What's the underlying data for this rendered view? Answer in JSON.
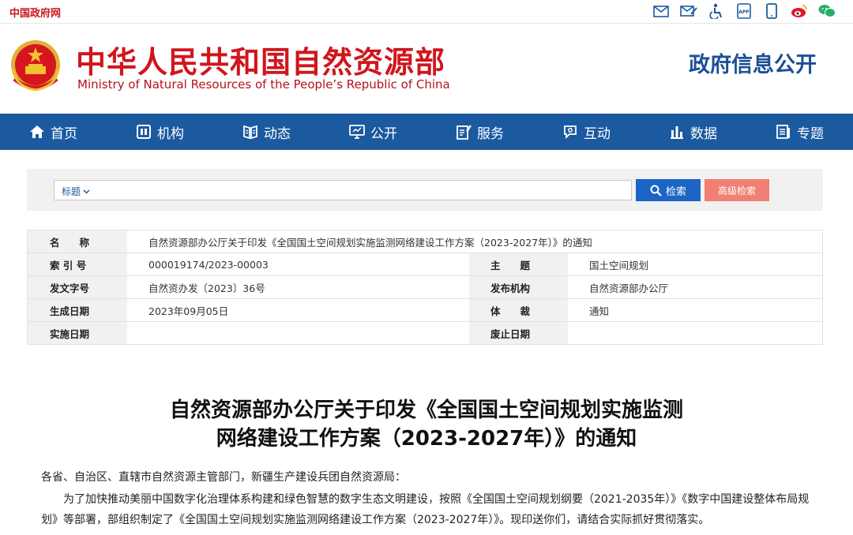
{
  "topbar": {
    "gov_link": "中国政府网",
    "icons": [
      "mail-icon",
      "mail-edit-icon",
      "accessibility-icon",
      "app-icon",
      "mobile-icon",
      "weibo-icon",
      "wechat-icon"
    ]
  },
  "header": {
    "title_cn": "中华人民共和国自然资源部",
    "title_en": "Ministry of Natural Resources of the People’s Republic of China",
    "section": "政府信息公开"
  },
  "nav": {
    "items": [
      {
        "label": "首页",
        "icon": "home-icon"
      },
      {
        "label": "机构",
        "icon": "org-icon"
      },
      {
        "label": "动态",
        "icon": "news-icon"
      },
      {
        "label": "公开",
        "icon": "disclosure-icon"
      },
      {
        "label": "服务",
        "icon": "service-icon"
      },
      {
        "label": "互动",
        "icon": "chat-icon"
      },
      {
        "label": "数据",
        "icon": "chart-icon"
      },
      {
        "label": "专题",
        "icon": "topic-icon"
      }
    ]
  },
  "search": {
    "category": "标题",
    "query": "",
    "search_label": "检索",
    "advanced_label": "高级检索"
  },
  "meta": {
    "name_label": "名　　称",
    "name_value": "自然资源部办公厅关于印发《全国国土空间规划实施监测网络建设工作方案（2023-2027年）》的通知",
    "index_label": "索 引 号",
    "index_value": "000019174/2023-00003",
    "subject_label": "主　　题",
    "subject_value": "国土空间规划",
    "docno_label": "发文字号",
    "docno_value": "自然资办发〔2023〕36号",
    "issuer_label": "发布机构",
    "issuer_value": "自然资源部办公厅",
    "created_label": "生成日期",
    "created_value": "2023年09月05日",
    "genre_label": "体　　裁",
    "genre_value": "通知",
    "effective_label": "实施日期",
    "effective_value": "",
    "expiry_label": "废止日期",
    "expiry_value": ""
  },
  "article": {
    "title_line1": "自然资源部办公厅关于印发《全国国土空间规划实施监测",
    "title_line2": "网络建设工作方案（2023-2027年）》的通知",
    "salutation": "各省、自治区、直辖市自然资源主管部门，新疆生产建设兵团自然资源局：",
    "body": "为了加快推动美丽中国数字化治理体系构建和绿色智慧的数字生态文明建设，按照《全国国土空间规划纲要（2021-2035年）》《数字中国建设整体布局规划》等部署，部组织制定了《全国国土空间规划实施监测网络建设工作方案（2023-2027年）》。现印送你们，请结合实际抓好贯彻落实。"
  },
  "colors": {
    "brand_red": "#d0161d",
    "nav_blue": "#1c5aa0",
    "search_blue": "#1c65c4",
    "advanced_salmon": "#f08073"
  }
}
